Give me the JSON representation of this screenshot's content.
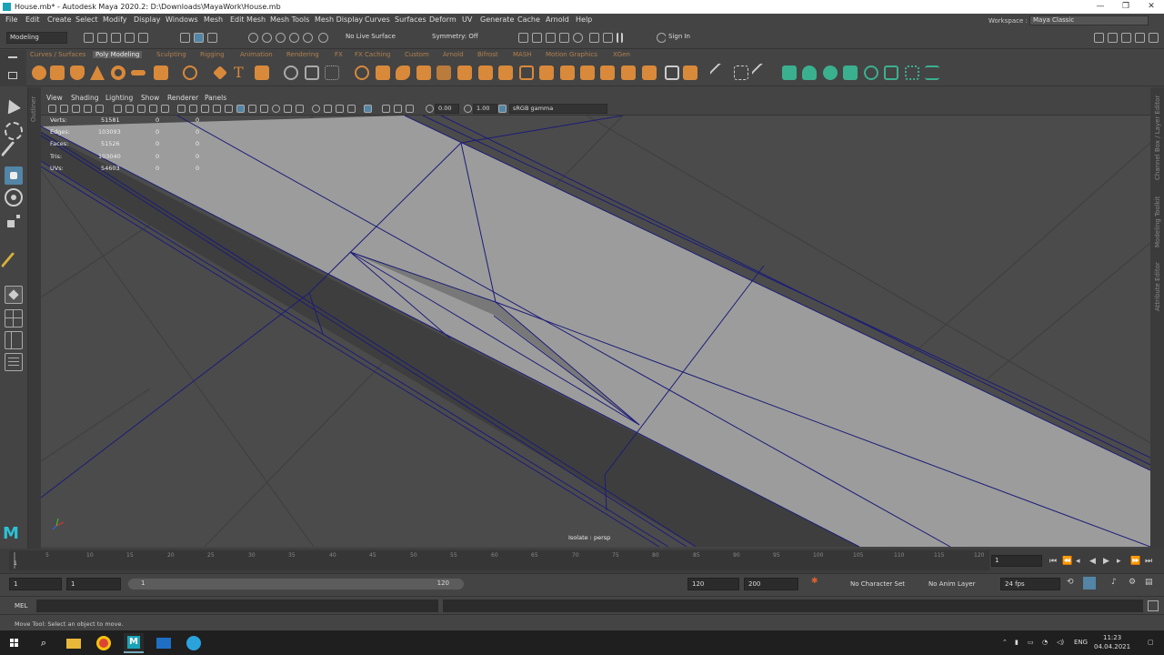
{
  "window": {
    "title": "House.mb* - Autodesk Maya 2020.2: D:\\Downloads\\MayaWork\\House.mb",
    "controls": [
      "—",
      "❐",
      "✕"
    ]
  },
  "menu": [
    "File",
    "Edit",
    "Create",
    "Select",
    "Modify",
    "Display",
    "Windows",
    "Mesh",
    "Edit Mesh",
    "Mesh Tools",
    "Mesh Display",
    "Curves",
    "Surfaces",
    "Deform",
    "UV",
    "Generate",
    "Cache",
    "Arnold",
    "Help"
  ],
  "workspace": {
    "label": "Workspace :",
    "value": "Maya Classic"
  },
  "status_line": {
    "mode": "Modeling",
    "live_surface": "No Live Surface",
    "symmetry": "Symmetry: Off",
    "sign_in": "Sign In"
  },
  "shelf_tabs": [
    "Curves / Surfaces",
    "Poly Modeling",
    "Sculpting",
    "Rigging",
    "Animation",
    "Rendering",
    "FX",
    "FX Caching",
    "Custom",
    "Arnold",
    "Bifrost",
    "MASH",
    "Motion Graphics",
    "XGen"
  ],
  "active_shelf_tab": "Poly Modeling",
  "panel_menu": [
    "View",
    "Shading",
    "Lighting",
    "Show",
    "Renderer",
    "Panels"
  ],
  "panel_toolbar": {
    "exposure": "0.00",
    "gamma": "1.00",
    "color_space": "sRGB gamma"
  },
  "side_labels": {
    "left": "Outliner",
    "right": [
      "Channel Box / Layer Editor",
      "Modeling Toolkit",
      "Attribute Editor"
    ]
  },
  "hud": [
    {
      "label": "Verts:",
      "values": [
        "51581",
        "0",
        "0"
      ]
    },
    {
      "label": "Edges:",
      "values": [
        "103093",
        "0",
        "0"
      ]
    },
    {
      "label": "Faces:",
      "values": [
        "51526",
        "0",
        "0"
      ]
    },
    {
      "label": "Tris:",
      "values": [
        "103040",
        "0",
        "0"
      ]
    },
    {
      "label": "UVs:",
      "values": [
        "54603",
        "0",
        "0"
      ]
    }
  ],
  "viewport": {
    "isolate_label": "Isolate : persp"
  },
  "timeline": {
    "ticks": [
      "5",
      "10",
      "15",
      "20",
      "25",
      "30",
      "35",
      "40",
      "45",
      "50",
      "55",
      "60",
      "65",
      "70",
      "75",
      "80",
      "85",
      "90",
      "95",
      "100",
      "105",
      "110",
      "115",
      "120"
    ],
    "start_marker": "1",
    "current_frame": "1"
  },
  "range": {
    "start": "1",
    "playback_start": "1",
    "bar_start": "1",
    "bar_end": "120",
    "playback_end": "120",
    "end": "200",
    "character_set": "No Character Set",
    "anim_layer": "No Anim Layer",
    "fps": "24 fps"
  },
  "command_line": {
    "label": "MEL"
  },
  "help_line": "Move Tool: Select an object to move.",
  "taskbar": {
    "lang": "ENG",
    "time": "11:23",
    "date": "04.04.2021"
  }
}
